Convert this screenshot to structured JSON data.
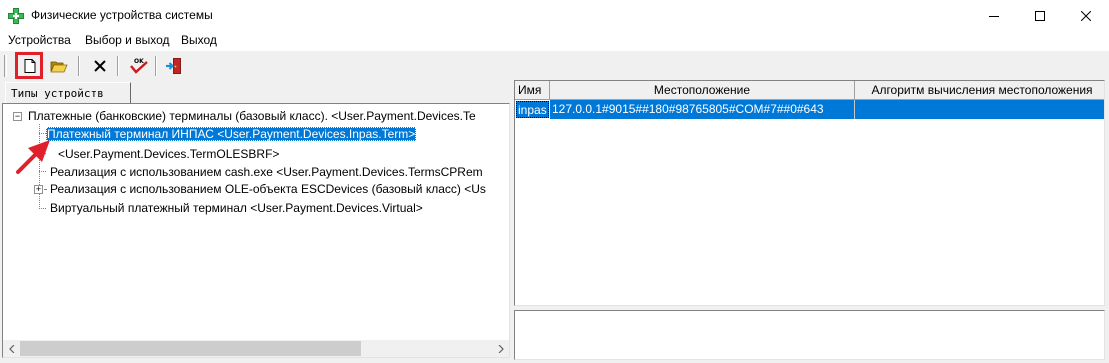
{
  "window": {
    "title": "Физические устройства системы",
    "accent_color": "#0078d7",
    "highlight_color": "#e0202a"
  },
  "menu": [
    "Устройства",
    "Выбор и выход",
    "Выход"
  ],
  "toolbar": {
    "icons": [
      "new-document-icon",
      "open-folder-icon",
      "delete-icon",
      "ok-check-icon",
      "exit-door-icon"
    ]
  },
  "left_panel": {
    "tab_label": "Типы устройств",
    "tree": [
      {
        "label": "Платежные (банковские) терминалы (базовый класс). <User.Payment.Devices.Te",
        "level": 0,
        "expander": "−"
      },
      {
        "label": "Платежный терминал ИНПАС <User.Payment.Devices.Inpas.Term>",
        "level": 1,
        "selected": true
      },
      {
        "label": "<User.Payment.Devices.TermOLESBRF>",
        "level": 1
      },
      {
        "label": "Реализация с использованием cash.exe <User.Payment.Devices.TermsCPRem",
        "level": 1
      },
      {
        "label": "Реализация с использованием OLE-объекта ESCDevices (базовый класс)  <Us",
        "level": 1,
        "expander": "+"
      },
      {
        "label": "Виртуальный платежный терминал <User.Payment.Devices.Virtual>",
        "level": 1
      }
    ]
  },
  "grid": {
    "columns": [
      "Имя",
      "Местоположение",
      "Алгоритм вычисления местоположения"
    ],
    "rows": [
      [
        "inpas",
        "127.0.0.1#9015##180#98765805#COM#7##0#643",
        ""
      ]
    ]
  }
}
